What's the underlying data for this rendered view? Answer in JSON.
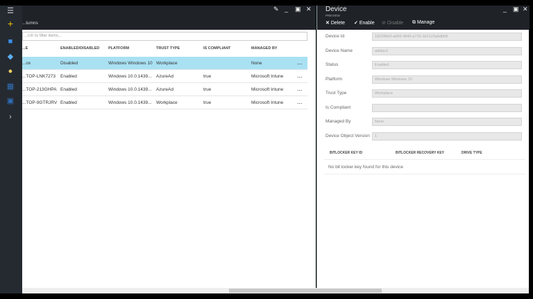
{
  "sidebar": {
    "items": [
      "menu-icon",
      "new-icon",
      "dashboard-icon",
      "resources-icon",
      "clock-icon",
      "grid-icon",
      "monitor-icon",
      "expand-icon"
    ]
  },
  "left": {
    "title": "...lumns",
    "search_placeholder": "...rch to filter items...",
    "columns": [
      "...E",
      "ENABLED/DISABLED",
      "PLATFORM",
      "TRUST TYPE",
      "IS COMPLIANT",
      "MANAGED BY"
    ],
    "rows": [
      {
        "name": "...ox",
        "enabled": "Disabled",
        "platform": "Windows Windows 10",
        "trust": "Workplace",
        "compliant": "",
        "managed": "None",
        "selected": true
      },
      {
        "name": "...TOP-LNK7273",
        "enabled": "Enabled",
        "platform": "Windows 10.0.1439...",
        "trust": "AzureAd",
        "compliant": "true",
        "managed": "Microsoft Intune"
      },
      {
        "name": "...TOP-213GHPA",
        "enabled": "Enabled",
        "platform": "Windows 10.0.1439...",
        "trust": "AzureAd",
        "compliant": "true",
        "managed": "Microsoft Intune"
      },
      {
        "name": "...TOP-9GTRJRV",
        "enabled": "Enabled",
        "platform": "Windows 10.0.1439...",
        "trust": "Workplace",
        "compliant": "true",
        "managed": "Microsoft Intune"
      }
    ],
    "more": "..."
  },
  "right": {
    "title": "Device",
    "subtitle": "PREVIEW",
    "toolbar": {
      "delete": "Delete",
      "enable": "Enable",
      "disable": "Disable",
      "manage": "Manage"
    },
    "fields": [
      {
        "label": "Device Id",
        "value": "182289e0-a666-4843-a716-1b2123a6db68"
      },
      {
        "label": "Device Name",
        "value": "adelpc1"
      },
      {
        "label": "Status",
        "value": "Enabled"
      },
      {
        "label": "Platform",
        "value": "Windows Windows 10"
      },
      {
        "label": "Trust Type",
        "value": "Workplace"
      },
      {
        "label": "Is Compliant",
        "value": ""
      },
      {
        "label": "Managed By",
        "value": "None"
      },
      {
        "label": "Device Object Version",
        "value": "1"
      }
    ],
    "bitlocker": {
      "columns": [
        "BITLOCKER KEY ID",
        "BITLOCKER RECOVERY KEY",
        "DRIVE TYPE"
      ],
      "empty": "No bit locker key found for this device"
    }
  },
  "colors": {
    "selected_row": "#a9e1f3",
    "header": "#1f2328",
    "sidebar": "#252a31",
    "add_icon": "#e8c200"
  }
}
